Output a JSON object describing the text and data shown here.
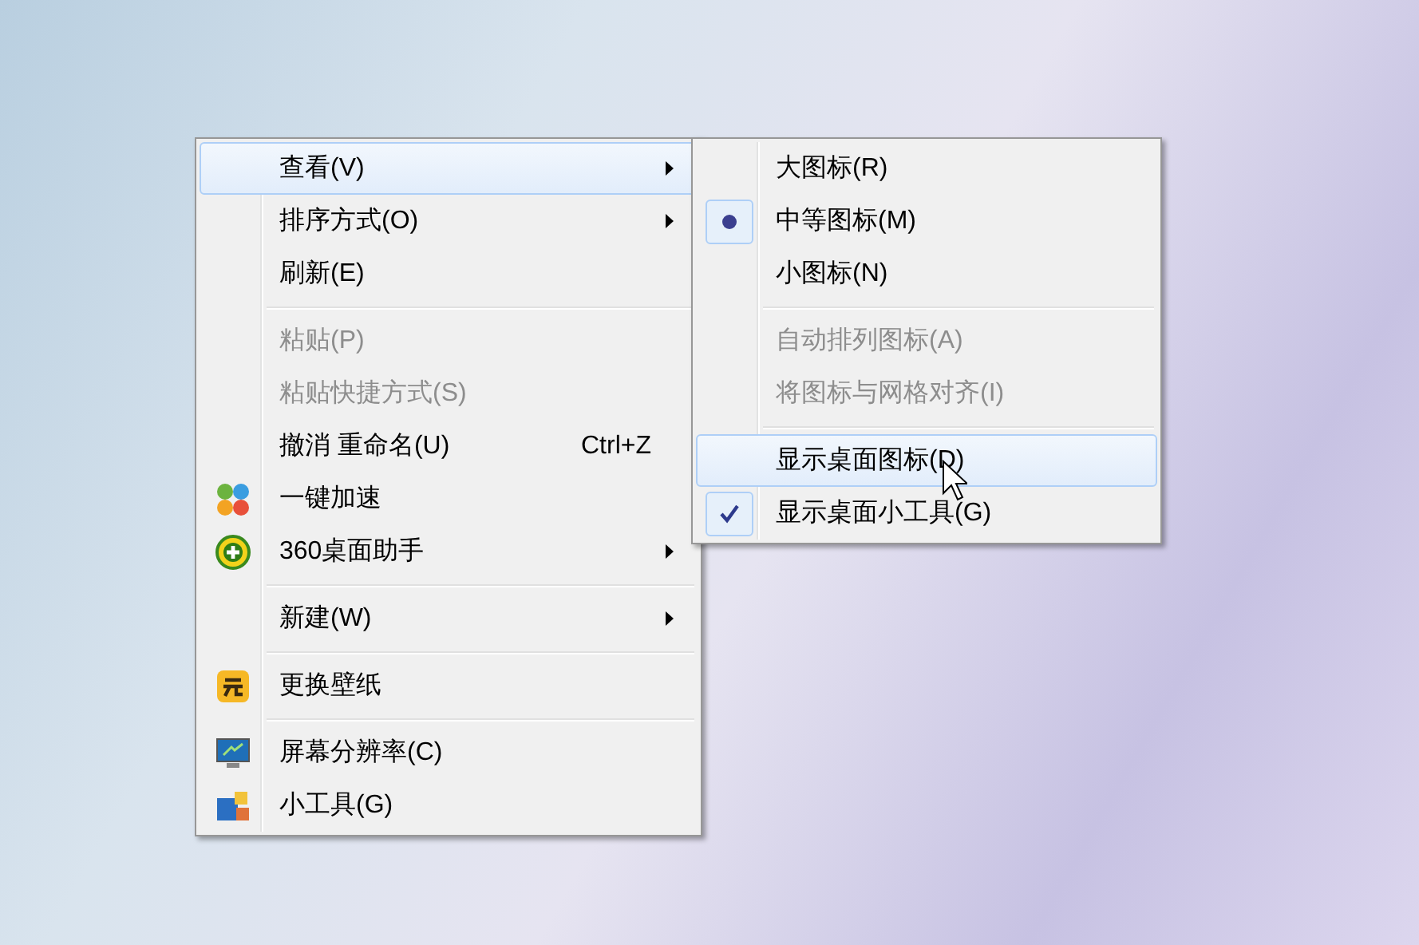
{
  "context_menu": {
    "sections": [
      [
        {
          "label": "查看(V)",
          "submenu": true,
          "disabled": false,
          "selected": true
        },
        {
          "label": "排序方式(O)",
          "submenu": true,
          "disabled": false,
          "selected": false
        },
        {
          "label": "刷新(E)",
          "submenu": false,
          "disabled": false,
          "selected": false
        }
      ],
      [
        {
          "label": "粘贴(P)",
          "submenu": false,
          "disabled": true,
          "selected": false
        },
        {
          "label": "粘贴快捷方式(S)",
          "submenu": false,
          "disabled": true,
          "selected": false
        },
        {
          "label": "撤消 重命名(U)",
          "shortcut": "Ctrl+Z",
          "submenu": false,
          "disabled": false,
          "selected": false
        },
        {
          "label": "一键加速",
          "submenu": false,
          "disabled": false,
          "selected": false
        },
        {
          "label": "360桌面助手",
          "submenu": true,
          "disabled": false,
          "selected": false
        }
      ],
      [
        {
          "label": "新建(W)",
          "submenu": true,
          "disabled": false,
          "selected": false
        }
      ],
      [
        {
          "label": "更换壁纸",
          "submenu": false,
          "disabled": false,
          "selected": false
        }
      ],
      [
        {
          "label": "屏幕分辨率(C)",
          "submenu": false,
          "disabled": false,
          "selected": false
        },
        {
          "label": "小工具(G)",
          "submenu": false,
          "disabled": false,
          "selected": false
        }
      ]
    ]
  },
  "view_submenu": {
    "sections": [
      [
        {
          "label": "大图标(R)",
          "kind": "radio",
          "checked": false,
          "disabled": false,
          "selected": false
        },
        {
          "label": "中等图标(M)",
          "kind": "radio",
          "checked": true,
          "disabled": false,
          "selected": false
        },
        {
          "label": "小图标(N)",
          "kind": "radio",
          "checked": false,
          "disabled": false,
          "selected": false
        }
      ],
      [
        {
          "label": "自动排列图标(A)",
          "kind": "check",
          "checked": false,
          "disabled": true,
          "selected": false
        },
        {
          "label": "将图标与网格对齐(I)",
          "kind": "check",
          "checked": false,
          "disabled": true,
          "selected": false
        }
      ],
      [
        {
          "label": "显示桌面图标(D)",
          "kind": "check",
          "checked": false,
          "disabled": false,
          "selected": true
        },
        {
          "label": "显示桌面小工具(G)",
          "kind": "check",
          "checked": true,
          "disabled": false,
          "selected": false
        }
      ]
    ]
  }
}
